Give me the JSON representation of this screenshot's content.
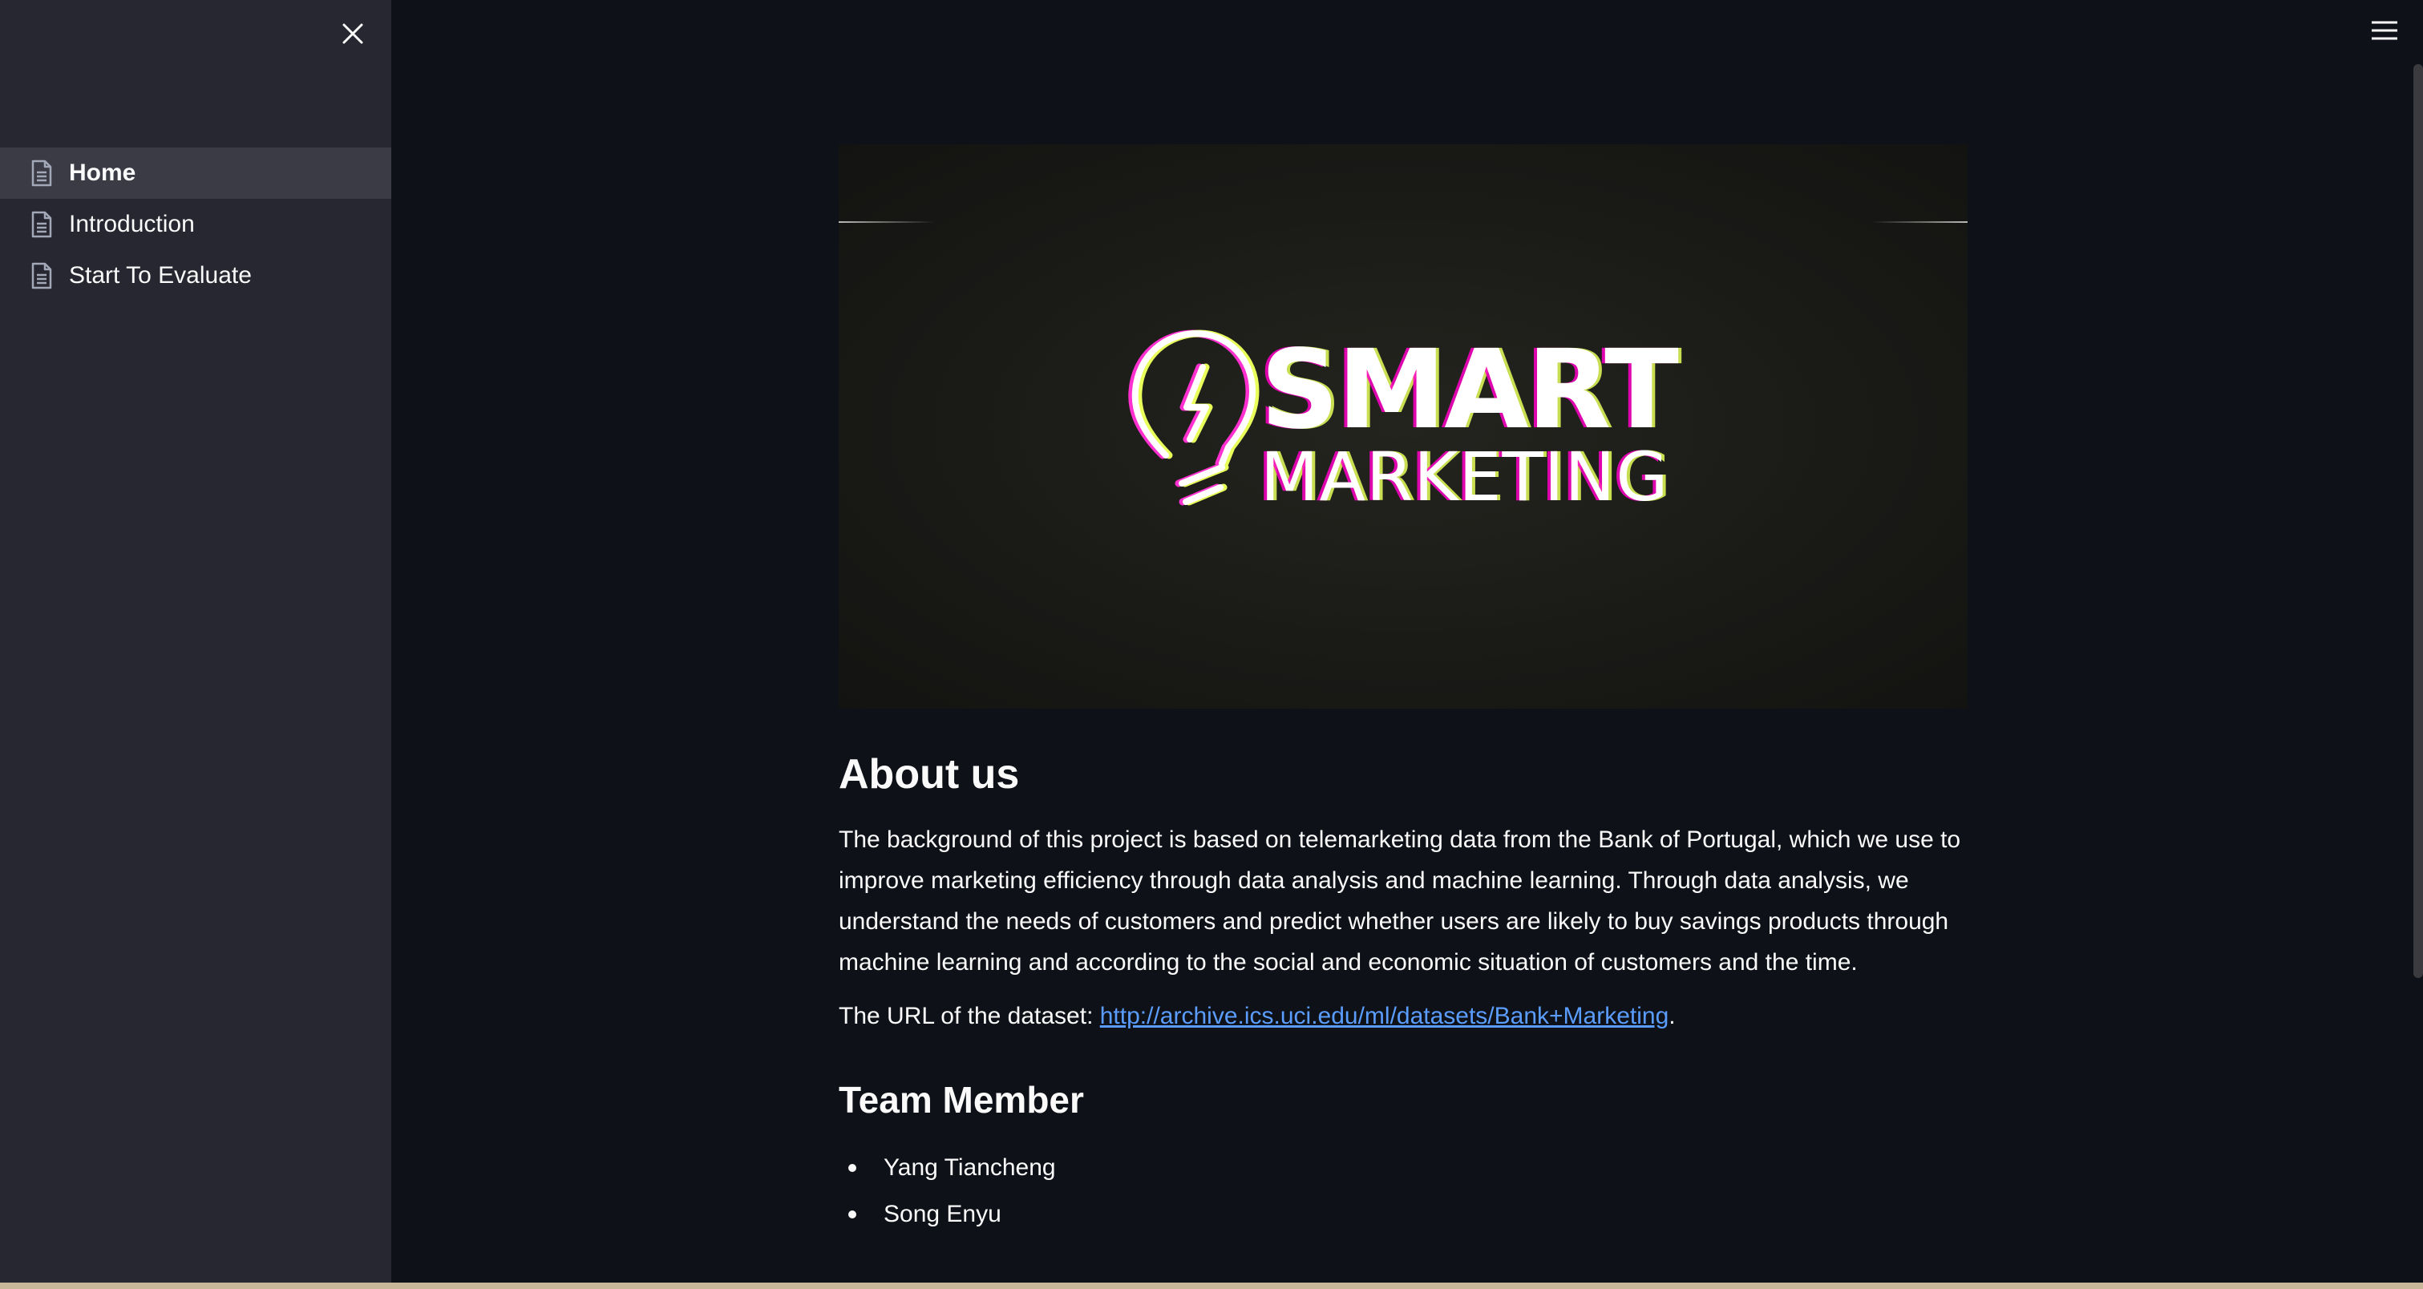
{
  "sidebar": {
    "items": [
      {
        "label": "Home",
        "icon": "document-icon",
        "active": true
      },
      {
        "label": "Introduction",
        "icon": "document-icon",
        "active": false
      },
      {
        "label": "Start To Evaluate",
        "icon": "document-icon",
        "active": false
      }
    ]
  },
  "hero": {
    "logo_line1": "SMART",
    "logo_line2": "MARKETING"
  },
  "about": {
    "title": "About us",
    "body": "The background of this project is based on telemarketing data from the Bank of Portugal, which we use to improve marketing efficiency through data analysis and machine learning. Through data analysis, we understand the needs of customers and predict whether users are likely to buy savings products through machine learning and according to the social and economic situation of customers and the time.",
    "url_prefix": "The URL of the dataset: ",
    "url": "http://archive.ics.uci.edu/ml/datasets/Bank+Marketing",
    "url_suffix": "."
  },
  "team": {
    "title": "Team Member",
    "members": [
      "Yang Tiancheng",
      "Song Enyu"
    ]
  },
  "colors": {
    "background": "#0e1117",
    "sidebar": "#262730",
    "link": "#5b9dff"
  }
}
